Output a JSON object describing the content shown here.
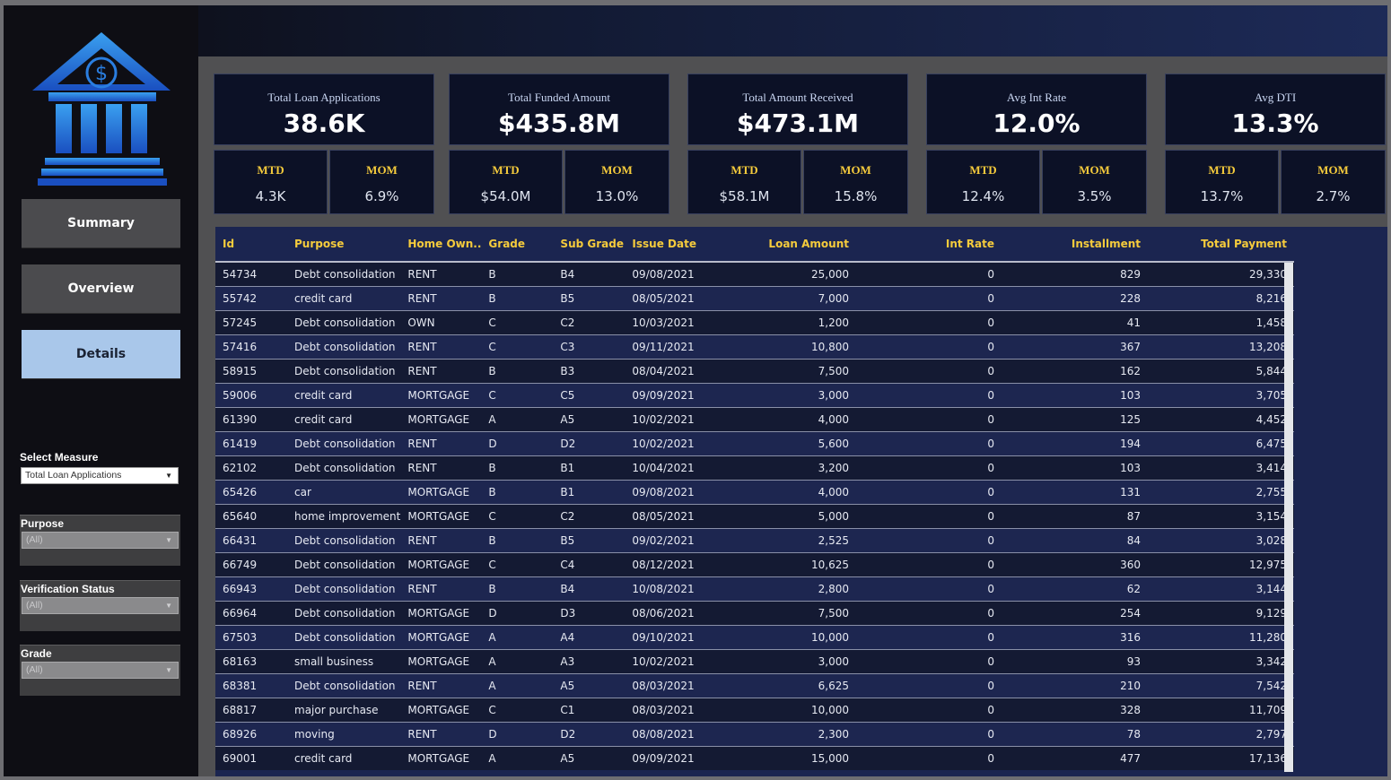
{
  "nav": {
    "summary": "Summary",
    "overview": "Overview",
    "details": "Details"
  },
  "filters": {
    "measure_label": "Select Measure",
    "measure_value": "Total Loan Applications",
    "purpose_label": "Purpose",
    "purpose_value": "(All)",
    "verification_label": "Verification Status",
    "verification_value": "(All)",
    "grade_label": "Grade",
    "grade_value": "(All)"
  },
  "kpis": [
    {
      "title": "Total Loan Applications",
      "value": "38.6K",
      "mtd_label": "MTD",
      "mtd": "4.3K",
      "mom_label": "MOM",
      "mom": "6.9%"
    },
    {
      "title": "Total Funded Amount",
      "value": "$435.8M",
      "mtd_label": "MTD",
      "mtd": "$54.0M",
      "mom_label": "MOM",
      "mom": "13.0%"
    },
    {
      "title": "Total Amount Received",
      "value": "$473.1M",
      "mtd_label": "MTD",
      "mtd": "$58.1M",
      "mom_label": "MOM",
      "mom": "15.8%"
    },
    {
      "title": "Avg Int Rate",
      "value": "12.0%",
      "mtd_label": "MTD",
      "mtd": "12.4%",
      "mom_label": "MOM",
      "mom": "3.5%"
    },
    {
      "title": "Avg DTI",
      "value": "13.3%",
      "mtd_label": "MTD",
      "mtd": "13.7%",
      "mom_label": "MOM",
      "mom": "2.7%"
    }
  ],
  "table": {
    "headers": [
      "Id",
      "Purpose",
      "Home Own..",
      "Grade",
      "Sub Grade",
      "Issue Date",
      "Loan Amount",
      "Int Rate",
      "Installment",
      "Total Payment"
    ],
    "rows": [
      [
        "54734",
        "Debt consolidation",
        "RENT",
        "B",
        "B4",
        "09/08/2021",
        "25,000",
        "0",
        "829",
        "29,330"
      ],
      [
        "55742",
        "credit card",
        "RENT",
        "B",
        "B5",
        "08/05/2021",
        "7,000",
        "0",
        "228",
        "8,216"
      ],
      [
        "57245",
        "Debt consolidation",
        "OWN",
        "C",
        "C2",
        "10/03/2021",
        "1,200",
        "0",
        "41",
        "1,458"
      ],
      [
        "57416",
        "Debt consolidation",
        "RENT",
        "C",
        "C3",
        "09/11/2021",
        "10,800",
        "0",
        "367",
        "13,208"
      ],
      [
        "58915",
        "Debt consolidation",
        "RENT",
        "B",
        "B3",
        "08/04/2021",
        "7,500",
        "0",
        "162",
        "5,844"
      ],
      [
        "59006",
        "credit card",
        "MORTGAGE",
        "C",
        "C5",
        "09/09/2021",
        "3,000",
        "0",
        "103",
        "3,705"
      ],
      [
        "61390",
        "credit card",
        "MORTGAGE",
        "A",
        "A5",
        "10/02/2021",
        "4,000",
        "0",
        "125",
        "4,452"
      ],
      [
        "61419",
        "Debt consolidation",
        "RENT",
        "D",
        "D2",
        "10/02/2021",
        "5,600",
        "0",
        "194",
        "6,475"
      ],
      [
        "62102",
        "Debt consolidation",
        "RENT",
        "B",
        "B1",
        "10/04/2021",
        "3,200",
        "0",
        "103",
        "3,414"
      ],
      [
        "65426",
        "car",
        "MORTGAGE",
        "B",
        "B1",
        "09/08/2021",
        "4,000",
        "0",
        "131",
        "2,755"
      ],
      [
        "65640",
        "home improvement",
        "MORTGAGE",
        "C",
        "C2",
        "08/05/2021",
        "5,000",
        "0",
        "87",
        "3,154"
      ],
      [
        "66431",
        "Debt consolidation",
        "RENT",
        "B",
        "B5",
        "09/02/2021",
        "2,525",
        "0",
        "84",
        "3,028"
      ],
      [
        "66749",
        "Debt consolidation",
        "MORTGAGE",
        "C",
        "C4",
        "08/12/2021",
        "10,625",
        "0",
        "360",
        "12,975"
      ],
      [
        "66943",
        "Debt consolidation",
        "RENT",
        "B",
        "B4",
        "10/08/2021",
        "2,800",
        "0",
        "62",
        "3,144"
      ],
      [
        "66964",
        "Debt consolidation",
        "MORTGAGE",
        "D",
        "D3",
        "08/06/2021",
        "7,500",
        "0",
        "254",
        "9,129"
      ],
      [
        "67503",
        "Debt consolidation",
        "MORTGAGE",
        "A",
        "A4",
        "09/10/2021",
        "10,000",
        "0",
        "316",
        "11,280"
      ],
      [
        "68163",
        "small business",
        "MORTGAGE",
        "A",
        "A3",
        "10/02/2021",
        "3,000",
        "0",
        "93",
        "3,342"
      ],
      [
        "68381",
        "Debt consolidation",
        "RENT",
        "A",
        "A5",
        "08/03/2021",
        "6,625",
        "0",
        "210",
        "7,542"
      ],
      [
        "68817",
        "major purchase",
        "MORTGAGE",
        "C",
        "C1",
        "08/03/2021",
        "10,000",
        "0",
        "328",
        "11,709"
      ],
      [
        "68926",
        "moving",
        "RENT",
        "D",
        "D2",
        "08/08/2021",
        "2,300",
        "0",
        "78",
        "2,797"
      ],
      [
        "69001",
        "credit card",
        "MORTGAGE",
        "A",
        "A5",
        "09/09/2021",
        "15,000",
        "0",
        "477",
        "17,136"
      ]
    ]
  }
}
